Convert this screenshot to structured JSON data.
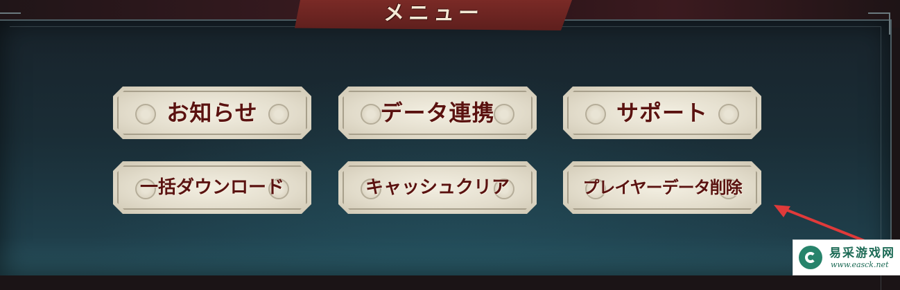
{
  "title": "メニュー",
  "menu": {
    "buttons": [
      {
        "label": "お知らせ"
      },
      {
        "label": "データ連携"
      },
      {
        "label": "サポート"
      },
      {
        "label": "一括ダウンロード"
      },
      {
        "label": "キャッシュクリア"
      },
      {
        "label": "プレイヤーデータ削除"
      }
    ]
  },
  "annotation": {
    "arrow_color": "#e03a3a"
  },
  "watermark": {
    "title": "易采游戏网",
    "url": "www.easck.net",
    "brand_color": "#27836b"
  },
  "colors": {
    "panel": "#1a2d36",
    "banner": "#6e2522",
    "button_face": "#e6e0cf",
    "button_text": "#5a1210"
  }
}
